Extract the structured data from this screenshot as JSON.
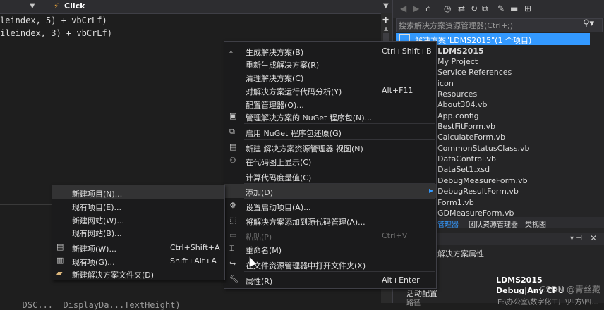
{
  "editor": {
    "method_name": "Click",
    "code_lines": [
      "leindex, 5) + vbCrLf)",
      "ileindex, 3) + vbCrLf)",
      "   DSC...  DisplayDa...TextHeight)"
    ]
  },
  "solution_explorer": {
    "search_placeholder": "搜索解决方案资源管理器(Ctrl+;)",
    "solution_label": "解决方案\"LDMS2015\"(1 个项目)",
    "project_label": "LDMS2015",
    "items": [
      "My Project",
      "Service References",
      "icon",
      "Resources",
      "About304.vb",
      "App.config",
      "BestFitForm.vb",
      "CalculateForm.vb",
      "CommonStatusClass.vb",
      "DataControl.vb",
      "DataSet1.xsd",
      "DebugMeasureForm.vb",
      "DebugResultForm.vb",
      "Form1.vb",
      "GDMeasureForm.vb"
    ],
    "tabs": [
      "管理器",
      "团队资源管理器",
      "类视图"
    ]
  },
  "properties": {
    "title": "解决方案属性",
    "rows": [
      {
        "name": "",
        "value": "LDMS2015"
      },
      {
        "name": "活动配置",
        "value": "Debug|Any CPU"
      },
      {
        "name": "路径",
        "value": "E:\\办公室\\数字化工厂\\四方\\四..."
      }
    ]
  },
  "watermark": "CSDN @青丝藏",
  "context_menu": {
    "items": [
      {
        "label": "生成解决方案(B)",
        "shortcut": "Ctrl+Shift+B",
        "icon": "build-icon"
      },
      {
        "label": "重新生成解决方案(R)",
        "shortcut": ""
      },
      {
        "label": "清理解决方案(C)",
        "shortcut": ""
      },
      {
        "label": "对解决方案运行代码分析(Y)",
        "shortcut": "Alt+F11"
      },
      {
        "label": "配置管理器(O)...",
        "shortcut": ""
      },
      {
        "label": "管理解决方案的 NuGet 程序包(N)...",
        "shortcut": "",
        "icon": "nuget-icon"
      },
      {
        "label": "启用 NuGet 程序包还原(G)",
        "shortcut": "",
        "icon": "restore-icon"
      },
      {
        "label": "新建 解决方案资源管理器 视图(N)",
        "shortcut": "",
        "icon": "new-view-icon"
      },
      {
        "label": "在代码图上显示(C)",
        "shortcut": "",
        "icon": "code-map-icon"
      },
      {
        "label": "计算代码度量值(C)",
        "shortcut": ""
      },
      {
        "label": "添加(D)",
        "shortcut": ""
      },
      {
        "label": "设置启动项目(A)...",
        "shortcut": "",
        "icon": "gear-icon"
      },
      {
        "label": "将解决方案添加到源代码管理(A)...",
        "shortcut": "",
        "icon": "source-control-icon"
      },
      {
        "label": "粘贴(P)",
        "shortcut": "Ctrl+V",
        "icon": "paste-icon"
      },
      {
        "label": "重命名(M)",
        "shortcut": "",
        "icon": "rename-icon"
      },
      {
        "label": "在文件资源管理器中打开文件夹(X)",
        "shortcut": "",
        "icon": "open-folder-icon"
      },
      {
        "label": "属性(R)",
        "shortcut": "Alt+Enter",
        "icon": "wrench-icon"
      }
    ]
  },
  "add_submenu": {
    "items": [
      {
        "label": "新建项目(N)...",
        "shortcut": ""
      },
      {
        "label": "现有项目(E)...",
        "shortcut": ""
      },
      {
        "label": "新建网站(W)...",
        "shortcut": ""
      },
      {
        "label": "现有网站(B)...",
        "shortcut": ""
      },
      {
        "label": "新建项(W)...",
        "shortcut": "Ctrl+Shift+A",
        "icon": "new-item-icon"
      },
      {
        "label": "现有项(G)...",
        "shortcut": "Shift+Alt+A",
        "icon": "existing-item-icon"
      },
      {
        "label": "新建解决方案文件夹(D)",
        "shortcut": "",
        "icon": "folder-icon"
      }
    ]
  },
  "colors": {
    "accent": "#3399ff",
    "menu_bg": "#1b1b1c",
    "editor_bg": "#1e1e1e"
  }
}
